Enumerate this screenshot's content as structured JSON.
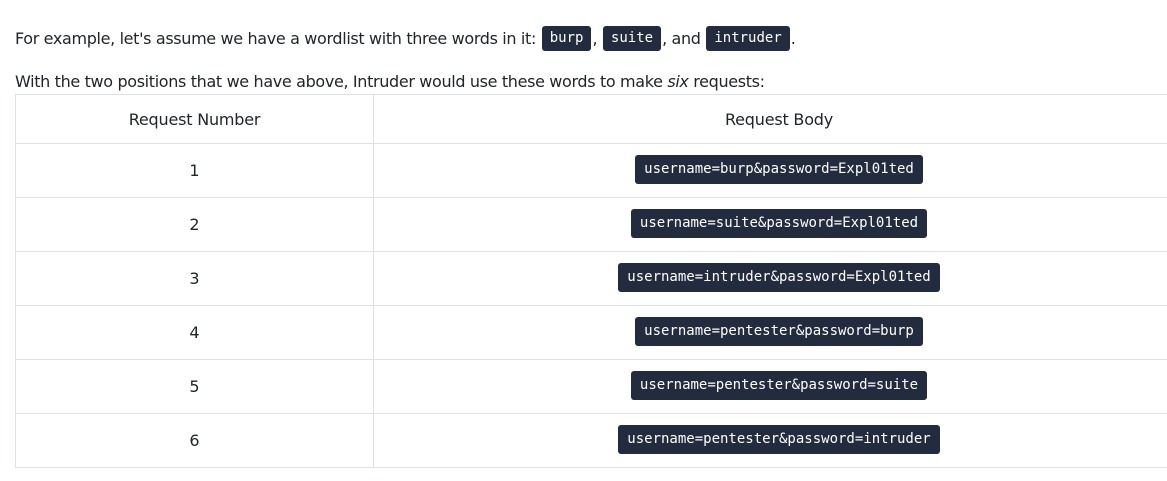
{
  "intro": {
    "lead": "For example, let's assume we have a wordlist with three words in it: ",
    "words": [
      "burp",
      "suite",
      "intruder"
    ],
    "sep1": ", ",
    "sep2": ", and ",
    "tail": "."
  },
  "explain": {
    "before": "With the two positions that we have above, Intruder would use these words to make ",
    "emphasis": "six",
    "after": " requests:"
  },
  "table": {
    "headers": [
      "Request Number",
      "Request Body"
    ],
    "rows": [
      {
        "number": "1",
        "body": "username=burp&password=Expl01ted"
      },
      {
        "number": "2",
        "body": "username=suite&password=Expl01ted"
      },
      {
        "number": "3",
        "body": "username=intruder&password=Expl01ted"
      },
      {
        "number": "4",
        "body": "username=pentester&password=burp"
      },
      {
        "number": "5",
        "body": "username=pentester&password=suite"
      },
      {
        "number": "6",
        "body": "username=pentester&password=intruder"
      }
    ]
  },
  "colors": {
    "code_bg": "#232b3e",
    "code_fg": "#ffffff",
    "border": "#dee2e6",
    "text": "#212529"
  }
}
